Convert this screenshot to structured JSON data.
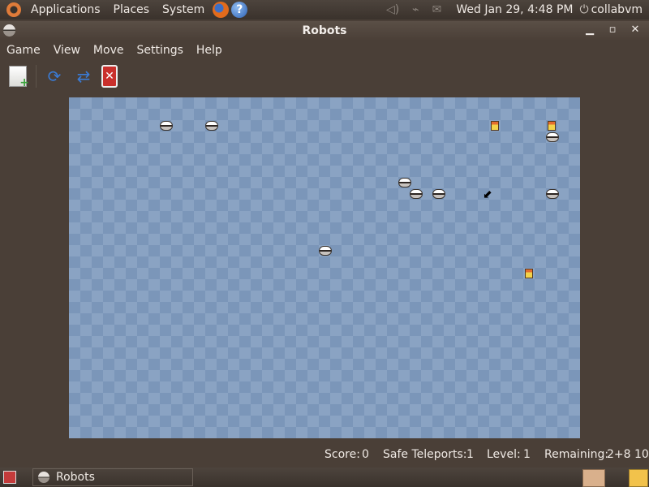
{
  "top_panel": {
    "menus": [
      "Applications",
      "Places",
      "System"
    ],
    "clock": "Wed Jan 29,  4:48 PM",
    "user": "collabvm"
  },
  "window": {
    "title": "Robots",
    "menubar": [
      {
        "label": "Game"
      },
      {
        "label": "View"
      },
      {
        "label": "Move"
      },
      {
        "label": "Settings"
      },
      {
        "label": "Help"
      }
    ]
  },
  "board": {
    "robots": [
      {
        "col": 8,
        "row": 2
      },
      {
        "col": 12,
        "row": 2
      },
      {
        "col": 42,
        "row": 3
      },
      {
        "col": 29,
        "row": 7
      },
      {
        "col": 30,
        "row": 8
      },
      {
        "col": 32,
        "row": 8
      },
      {
        "col": 42,
        "row": 8
      },
      {
        "col": 22,
        "row": 13
      }
    ],
    "junk": [
      {
        "col": 37,
        "row": 2
      },
      {
        "col": 42,
        "row": 2
      },
      {
        "col": 40,
        "row": 15
      }
    ]
  },
  "status": {
    "score_label": "Score:",
    "score": "0",
    "safe_label": "Safe Teleports:",
    "safe": "1",
    "level_label": "Level:",
    "level": "1",
    "remaining_label": "Remaining:",
    "remaining": "2+8 10"
  },
  "taskbar": {
    "task": "Robots"
  },
  "colors": {
    "panel": "#3a322c",
    "window_bg": "#4a3f37",
    "board_light": "#8aa3c3",
    "board_dark": "#7b96b9"
  }
}
